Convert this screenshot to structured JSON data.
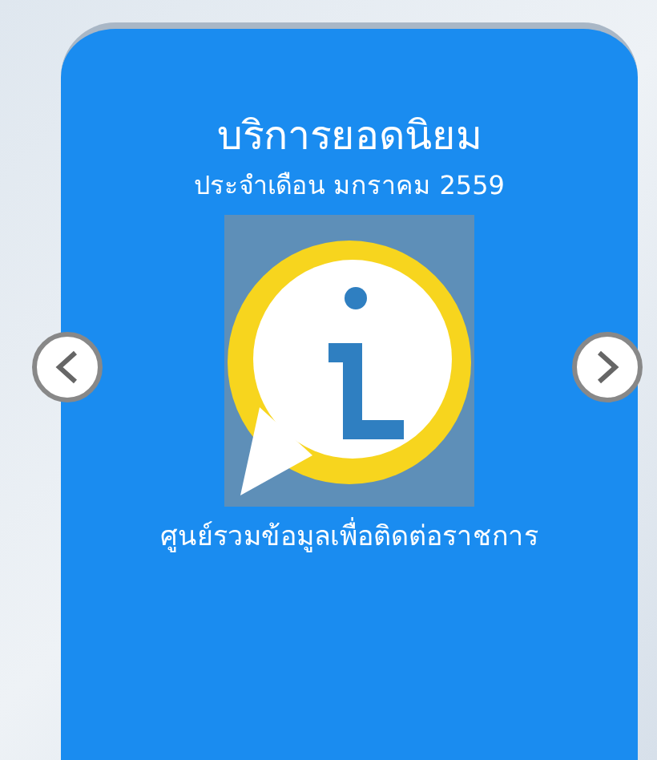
{
  "promo": {
    "title": "บริการยอดนิยม",
    "subtitle": "ประจำเดือน มกราคม 2559",
    "caption": "ศูนย์รวมข้อมูลเพื่อติดต่อราชการ"
  }
}
